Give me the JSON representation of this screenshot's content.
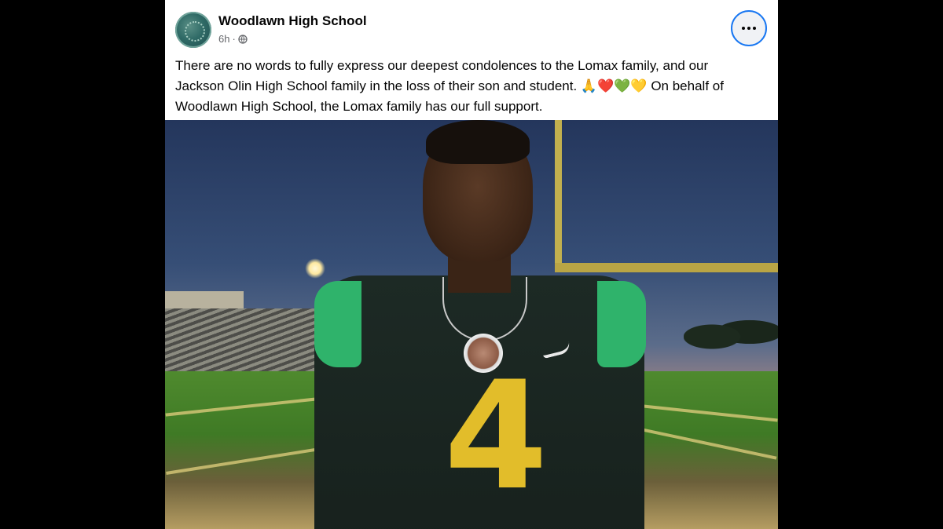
{
  "post": {
    "page_name": "Woodlawn High School",
    "time": "6h",
    "separator": "·",
    "caption_line1": "There are no words to fully express our deepest condolences to the Lomax family, and our",
    "caption_line2": "Jackson Olin High School family in the loss of their son and student. 🙏❤️💚💛 On behalf of",
    "caption_line3": "Woodlawn High School, the Lomax family has our full support.",
    "jersey_number": "4"
  },
  "icons": {
    "more": "more-options-icon",
    "audience": "globe-icon"
  },
  "colors": {
    "accent": "#1877f2",
    "jersey_green": "#2fb36b",
    "jersey_gold": "#e2bd2a"
  }
}
